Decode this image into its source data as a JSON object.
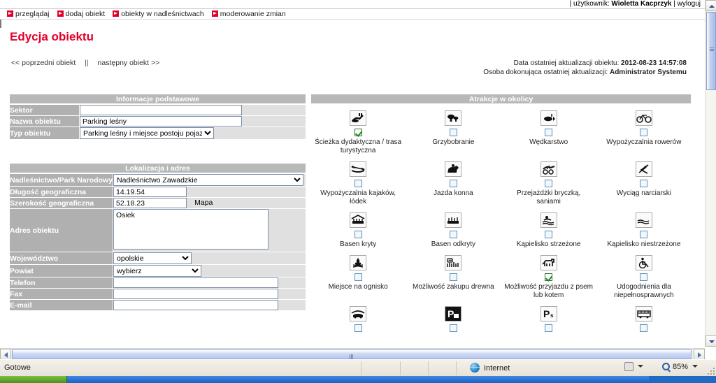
{
  "userstrip": {
    "prefix": "|",
    "label": "użytkownik:",
    "username": "Wioletta Kacprzyk",
    "divider": "|",
    "logout": "wyloguj"
  },
  "nav": {
    "items": [
      {
        "label": "przeglądaj",
        "icon": "red-arrow-icon"
      },
      {
        "label": "dodaj obiekt",
        "icon": "red-arrow-icon"
      },
      {
        "label": "obiekty w nadleśnictwach",
        "icon": "red-arrow-icon"
      },
      {
        "label": "moderowanie zmian",
        "icon": "red-arrow-icon"
      }
    ]
  },
  "page": {
    "title": "Edycja obiektu",
    "prev_link": "<< poprzedni obiekt",
    "separator": "||",
    "next_link": "następny obiekt >>"
  },
  "meta": {
    "updated_label": "Data ostatniej aktualizacji obiektu:",
    "updated_value": "2012-08-23 14:57:08",
    "updated_by_label": "Osoba dokonująca ostatniej aktualizacji:",
    "updated_by_value": "Administrator Systemu"
  },
  "basic": {
    "header": "Informacje podstawowe",
    "rows": [
      {
        "label": "Sektor",
        "type": "text",
        "value": "",
        "placeholder": ""
      },
      {
        "label": "Nazwa obiektu",
        "type": "text",
        "value": "Parking leśny",
        "placeholder": ""
      },
      {
        "label": "Typ obiektu",
        "type": "select",
        "value": "Parking leśny i miejsce postoju pojazdów"
      }
    ]
  },
  "location": {
    "header": "Lokalizacja i adres",
    "forest_label": "Nadleśnictwo/Park Narodowy",
    "forest_value": "Nadleśnictwo Zawadzkie",
    "lon_label": "Długość geograficzna",
    "lon_value": "14.19.54",
    "lat_label": "Szerokość geograficzna",
    "lat_value": "52.18.23",
    "map_link": "Mapa",
    "address_label": "Adres obiektu",
    "address_value": "Osiek",
    "voivodeship_label": "Województwo",
    "voivodeship_value": "opolskie",
    "county_label": "Powiat",
    "county_value": "wybierz",
    "phone_label": "Telefon",
    "phone_value": "",
    "fax_label": "Fax",
    "fax_value": "",
    "email_label": "E-mail",
    "email_value": ""
  },
  "attractions": {
    "header": "Atrakcje w okolicy",
    "items": [
      {
        "label": "Ścieżka dydaktyczna / trasa turystyczna",
        "icon": "educational-trail-icon",
        "checked": true
      },
      {
        "label": "Grzybobranie",
        "icon": "mushroom-icon",
        "checked": false
      },
      {
        "label": "Wędkarstwo",
        "icon": "fish-icon",
        "checked": false
      },
      {
        "label": "Wypożyczalnia rowerów",
        "icon": "bicycle-icon",
        "checked": false
      },
      {
        "label": "Wypożyczalnia kajaków, łódek",
        "icon": "kayak-icon",
        "checked": false
      },
      {
        "label": "Jazda konna",
        "icon": "horse-riding-icon",
        "checked": false
      },
      {
        "label": "Przejażdżki bryczką, saniami",
        "icon": "carriage-icon",
        "checked": false
      },
      {
        "label": "Wyciąg narciarski",
        "icon": "ski-lift-icon",
        "checked": false
      },
      {
        "label": "Basen kryty",
        "icon": "indoor-pool-icon",
        "checked": false
      },
      {
        "label": "Basen odkryty",
        "icon": "outdoor-pool-icon",
        "checked": false
      },
      {
        "label": "Kąpielisko strzeżone",
        "icon": "guarded-beach-icon",
        "checked": false
      },
      {
        "label": "Kąpielisko niestrzeżone",
        "icon": "unguarded-beach-icon",
        "checked": false
      },
      {
        "label": "Miejsce na ognisko",
        "icon": "campfire-icon",
        "checked": false
      },
      {
        "label": "Możliwość zakupu drewna",
        "icon": "firewood-icon",
        "checked": false
      },
      {
        "label": "Możliwość przyjazdu z psem lub kotem",
        "icon": "pet-icon",
        "checked": true
      },
      {
        "label": "Udogodnienia dla niepełnosprawnych",
        "icon": "wheelchair-icon",
        "checked": false
      },
      {
        "label": "",
        "icon": "car-shelter-icon",
        "checked": false
      },
      {
        "label": "",
        "icon": "parking-paid-icon",
        "checked": false
      },
      {
        "label": "",
        "icon": "parking-small-icon",
        "checked": false
      },
      {
        "label": "",
        "icon": "bus-icon",
        "checked": false
      }
    ]
  },
  "statusbar": {
    "status": "Gotowe",
    "zone": "Internet",
    "zoom": "85%"
  }
}
